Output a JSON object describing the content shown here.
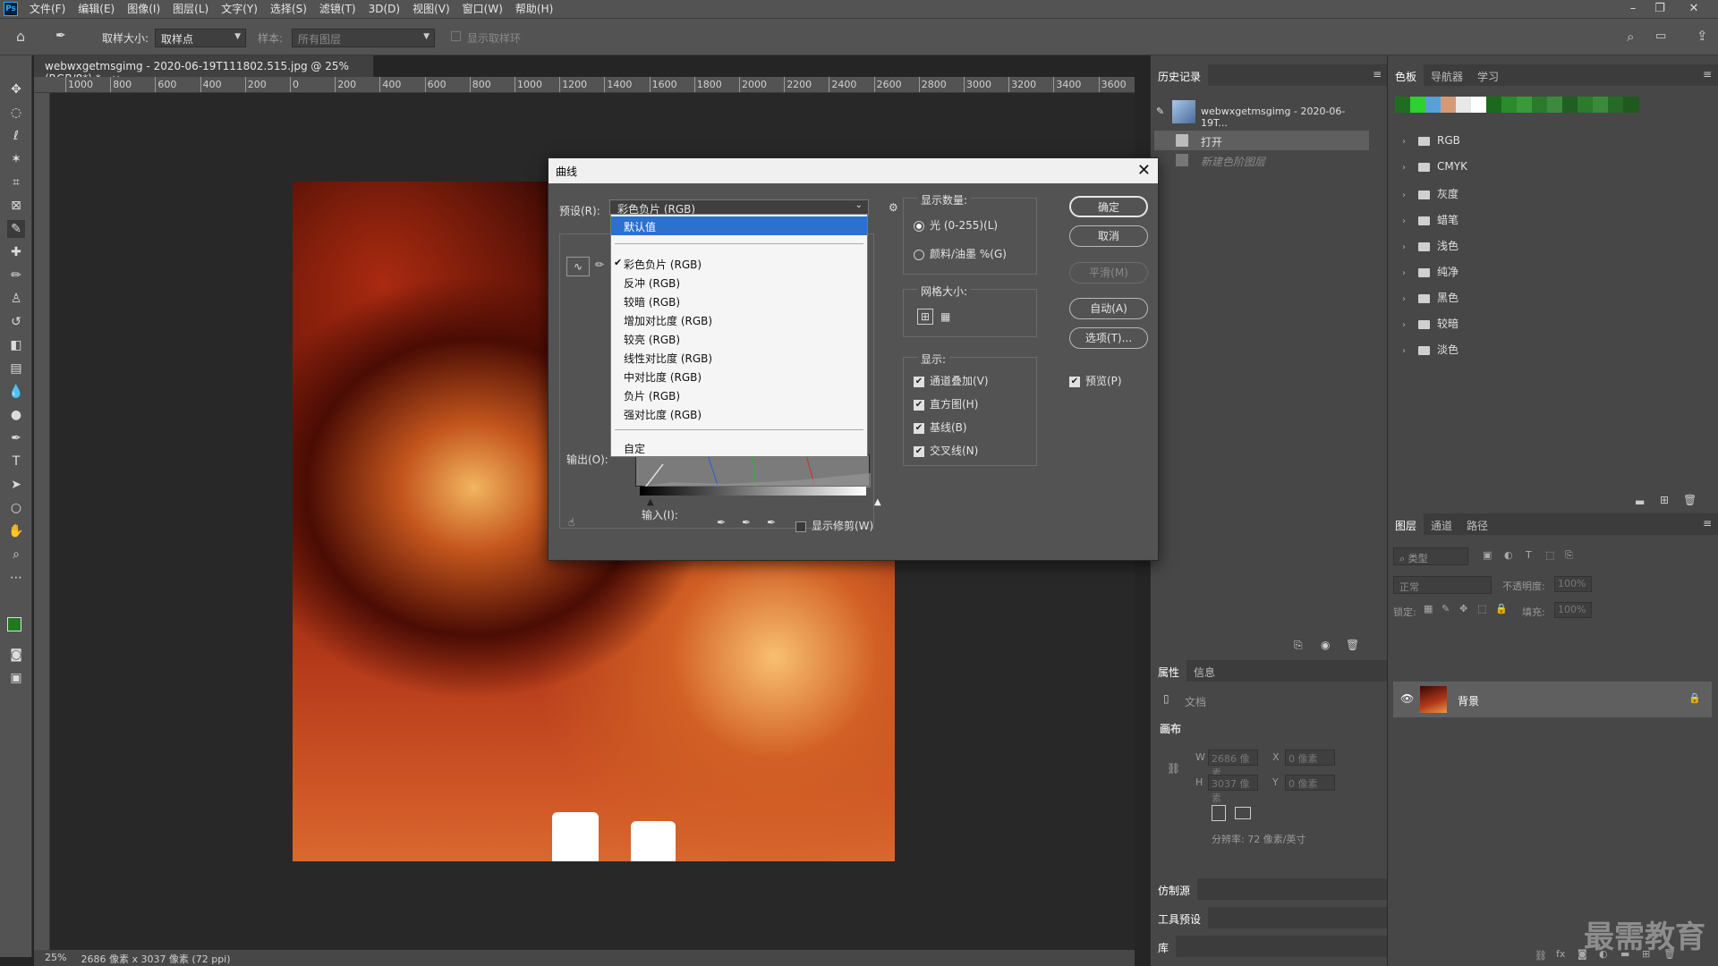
{
  "menubar": {
    "items": [
      "文件(F)",
      "编辑(E)",
      "图像(I)",
      "图层(L)",
      "文字(Y)",
      "选择(S)",
      "滤镜(T)",
      "3D(D)",
      "视图(V)",
      "窗口(W)",
      "帮助(H)"
    ]
  },
  "options": {
    "sample_size_label": "取样大小:",
    "sample_size_value": "取样点",
    "sample_label": "样本:",
    "sample_value": "所有图层",
    "show_ring_label": "显示取样环"
  },
  "document": {
    "tab_title": "webwxgetmsgimg - 2020-06-19T111802.515.jpg @ 25%(RGB/8*) *",
    "ruler_ticks": [
      "1000",
      "800",
      "600",
      "400",
      "200",
      "0",
      "200",
      "400",
      "600",
      "800",
      "1000",
      "1200",
      "1400",
      "1600",
      "1800",
      "2000",
      "2200",
      "2400",
      "2600",
      "2800",
      "3000",
      "3200",
      "3400",
      "3600"
    ]
  },
  "status": {
    "zoom": "25%",
    "doc_size": "2686 像素 x 3037 像素 (72 ppi)"
  },
  "curves_dialog": {
    "title": "曲线",
    "preset_label": "预设(R):",
    "preset_value": "彩色负片 (RGB)",
    "output_label": "输出(O):",
    "input_label": "输入(I):",
    "show_clipping": "显示修剪(W)",
    "display_amount_label": "显示数量:",
    "light_option": "光 (0-255)(L)",
    "pigment_option": "颜料/油墨 %(G)",
    "grid_size_label": "网格大小:",
    "show_label": "显示:",
    "channel_overlay": "通道叠加(V)",
    "histogram": "直方图(H)",
    "baseline": "基线(B)",
    "intersection": "交叉线(N)",
    "buttons": {
      "ok": "确定",
      "cancel": "取消",
      "smooth": "平滑(M)",
      "auto": "自动(A)",
      "options": "选项(T)..."
    },
    "preview": "预览(P)",
    "dropdown": {
      "default": "默认值",
      "items": [
        "彩色负片 (RGB)",
        "反冲 (RGB)",
        "较暗 (RGB)",
        "增加对比度 (RGB)",
        "较亮 (RGB)",
        "线性对比度 (RGB)",
        "中对比度 (RGB)",
        "负片 (RGB)",
        "强对比度 (RGB)"
      ],
      "custom": "自定",
      "checked_item": "彩色负片 (RGB)"
    }
  },
  "history_panel": {
    "tab": "历史记录",
    "snapshot": "webwxgetmsgimg - 2020-06-19T...",
    "steps": [
      "打开",
      "新建色阶图层"
    ]
  },
  "properties_panel": {
    "tabs": [
      "属性",
      "信息"
    ],
    "doc_label": "文档",
    "canvas_label": "画布",
    "w_label": "W",
    "h_label": "H",
    "x_label": "X",
    "y_label": "Y",
    "w_value": "2686 像素",
    "h_value": "3037 像素",
    "x_value": "0 像素",
    "y_value": "0 像素",
    "resolution": "分辨率: 72 像素/英寸"
  },
  "collapsed_panels": [
    "仿制源",
    "工具预设",
    "库"
  ],
  "swatches_panel": {
    "tabs": [
      "色板",
      "导航器",
      "学习"
    ],
    "colors": [
      "#1f6e1f",
      "#2fd02f",
      "#5aa0d8",
      "#d49a78",
      "#e8e8e8",
      "#ffffff",
      "#1b6a1b",
      "#2b8a2b",
      "#3a9a3a",
      "#2a7a2a",
      "#3d8a3d",
      "#1f5f1f",
      "#2b7b2b",
      "#3a8a3a",
      "#256a25",
      "#1e5a1e"
    ],
    "groups": [
      "RGB",
      "CMYK",
      "灰度",
      "蜡笔",
      "浅色",
      "纯净",
      "黑色",
      "较暗",
      "淡色"
    ]
  },
  "layers_panel": {
    "tabs": [
      "图层",
      "通道",
      "路径"
    ],
    "filter_placeholder": "类型",
    "blend_mode": "正常",
    "opacity_label": "不透明度:",
    "opacity_value": "100%",
    "lock_label": "锁定:",
    "fill_label": "填充:",
    "fill_value": "100%",
    "layer_name": "背景"
  },
  "watermark": "最需教育"
}
